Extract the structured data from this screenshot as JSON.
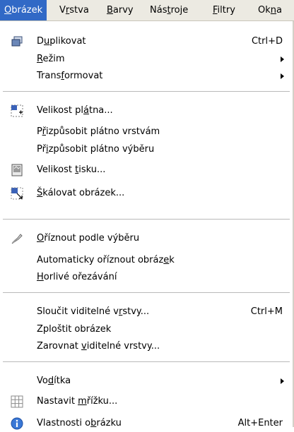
{
  "menubar": [
    {
      "pre": "",
      "acc": "O",
      "post": "brázek"
    },
    {
      "pre": "V",
      "acc": "r",
      "post": "stva"
    },
    {
      "pre": "",
      "acc": "B",
      "post": "arvy"
    },
    {
      "pre": "Nás",
      "acc": "t",
      "post": "roje"
    },
    {
      "pre": "",
      "acc": "F",
      "post": "iltry"
    },
    {
      "pre": "Ok",
      "acc": "n",
      "post": "a"
    }
  ],
  "menu": {
    "duplicate": {
      "pre": "D",
      "acc": "u",
      "post": "plikovat",
      "shortcut": "Ctrl+D",
      "icon": "duplicate-icon"
    },
    "mode": {
      "pre": "",
      "acc": "R",
      "post": "ežim"
    },
    "transform": {
      "pre": "Trans",
      "acc": "f",
      "post": "ormovat"
    },
    "canvas_size": {
      "pre": "Velikost pl",
      "acc": "á",
      "post": "tna...",
      "icon": "canvas-size-icon"
    },
    "fit_layers": {
      "pre": "P",
      "acc": "ř",
      "post": "izpůsobit plátno vrstvám"
    },
    "fit_selection": {
      "pre": "Př",
      "acc": "i",
      "post": "způsobit plátno výběru"
    },
    "print_size": {
      "pre": "Velikost ",
      "acc": "t",
      "post": "isku...",
      "icon": "print-size-icon"
    },
    "scale_image": {
      "pre": "",
      "acc": "Š",
      "post": "kálovat obrázek...",
      "icon": "scale-image-icon"
    },
    "crop_selection": {
      "pre": "",
      "acc": "O",
      "post": "říznout podle výběru",
      "icon": "crop-icon"
    },
    "autocrop": {
      "pre": "Automaticky oříznout obráz",
      "acc": "e",
      "post": "k"
    },
    "zealous_crop": {
      "pre": "",
      "acc": "H",
      "post": "orlivé ořezávání"
    },
    "merge_visible": {
      "pre": "Sloučit viditelné v",
      "acc": "r",
      "post": "stvy...",
      "shortcut": "Ctrl+M"
    },
    "flatten": {
      "pre": "Zploštit obrázek",
      "acc": "",
      "post": ""
    },
    "align_layers": {
      "pre": "Zarovnat ",
      "acc": "v",
      "post": "iditelné vrstvy..."
    },
    "guides": {
      "pre": "Vo",
      "acc": "d",
      "post": "ítka"
    },
    "grid": {
      "pre": "Nastavit ",
      "acc": "m",
      "post": "řížku...",
      "icon": "grid-icon"
    },
    "properties": {
      "pre": "Vlastnosti o",
      "acc": "b",
      "post": "rázku",
      "shortcut": "Alt+Enter",
      "icon": "info-icon"
    }
  },
  "colors": {
    "highlight": "#3169c6",
    "menubar_bg": "#eceae2",
    "separator": "#b9b9b9"
  }
}
